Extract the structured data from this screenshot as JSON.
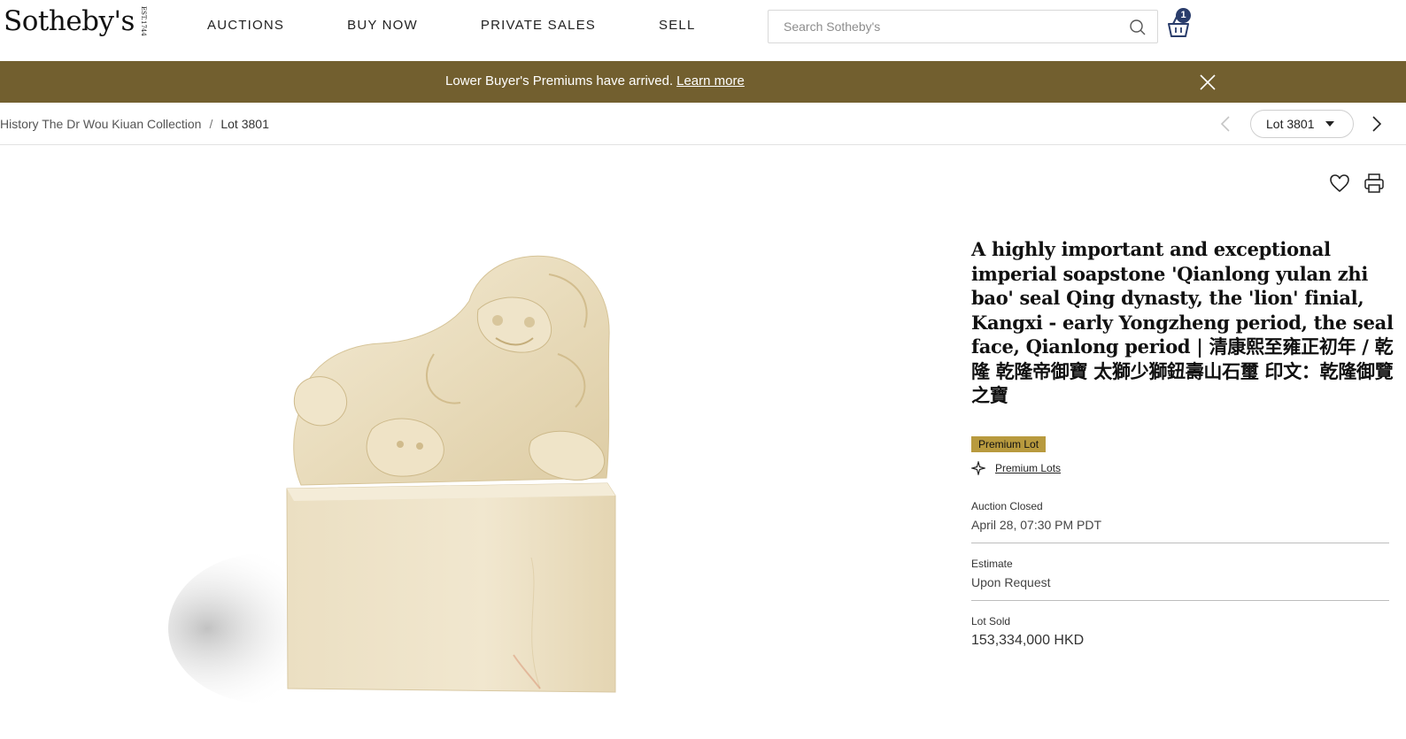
{
  "header": {
    "logo_text": "Sotheby's",
    "logo_est_lines": [
      "EST.",
      "1744"
    ],
    "nav": [
      "AUCTIONS",
      "BUY NOW",
      "PRIVATE SALES",
      "SELL"
    ],
    "search_placeholder": "Search Sotheby's",
    "cart_count": "1"
  },
  "banner": {
    "text": "Lower Buyer's Premiums have arrived.",
    "link": "Learn more",
    "bg_color": "#725f2f"
  },
  "breadcrumb": {
    "items": [
      "History The Dr Wou Kiuan Collection"
    ],
    "separator": "/",
    "current": "Lot 3801"
  },
  "lot_nav": {
    "selected": "Lot 3801"
  },
  "lot": {
    "title": "A highly important and exceptional imperial soapstone 'Qianlong yulan zhi bao' seal Qing dynasty, the 'lion' finial, Kangxi - early Yongzheng period, the seal face, Qianlong period | 清康熙至雍正初年 / 乾隆 乾隆帝御寶 太獅少獅鈕壽山石璽 印文：乾隆御覽之寶",
    "premium_badge": "Premium Lot",
    "premium_link": "Premium Lots",
    "auction_status_label": "Auction Closed",
    "auction_status_value": "April 28, 07:30 PM PDT",
    "estimate_label": "Estimate",
    "estimate_value": "Upon Request",
    "sold_label": "Lot Sold",
    "sold_value": "153,334,000 HKD",
    "badge_color": "#b89a3e"
  }
}
